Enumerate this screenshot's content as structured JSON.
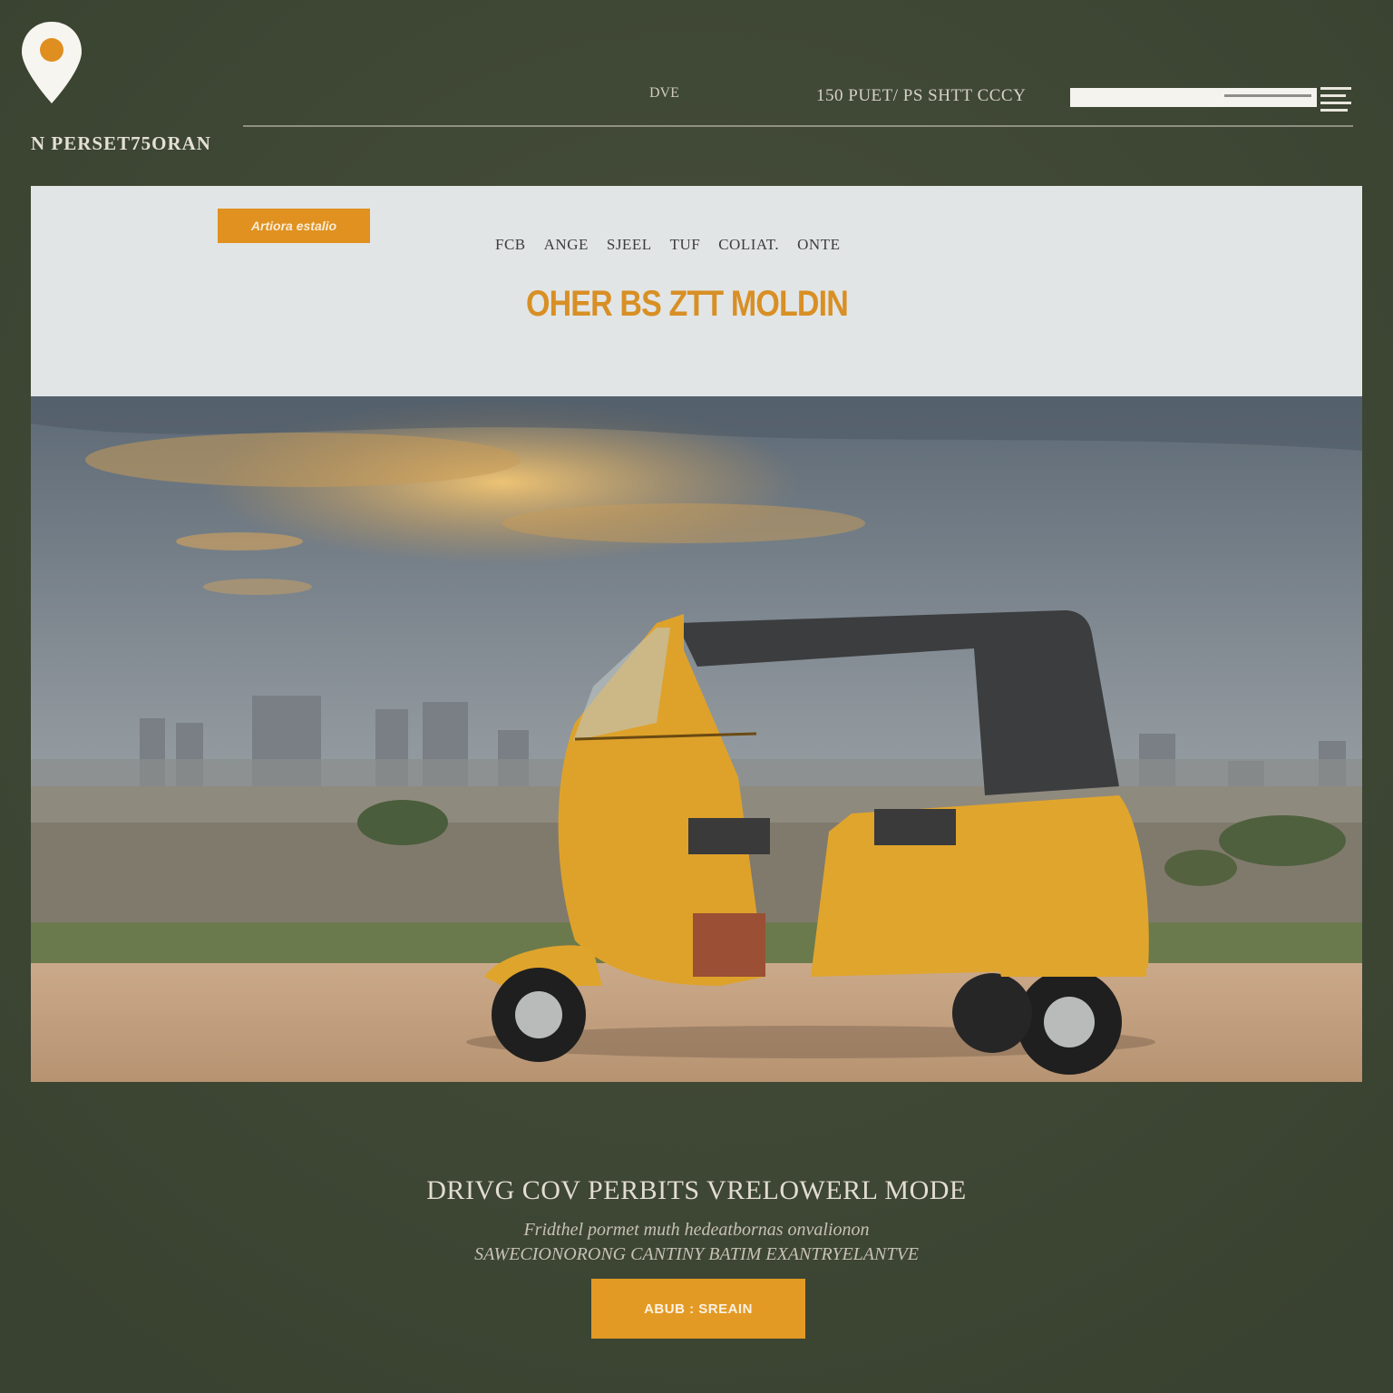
{
  "brand": {
    "name": "N PERSET75ORAN",
    "logo_icon": "location-pin-icon"
  },
  "topnav": {
    "item_one": "DVE",
    "item_two": "150 PUET/  PS  SHTT CCCY"
  },
  "search": {
    "placeholder": ""
  },
  "card": {
    "tag": "Artiora estalio",
    "categories": [
      "FCB",
      "ANGE",
      "SJEEL",
      "TUF",
      "COLIAT.",
      "ONTE"
    ],
    "headline": "OHER BS ZTT MOLDIN"
  },
  "footer": {
    "title": "DRIVG COV PERBITS   VRELOWERL MODE",
    "line1": "Fridthel pormet muth hedeatbornas onvalionon",
    "line2": "SAWECIONORONG CANTINY BATIM EXANTRYELANTVE",
    "cta": "ABUB : SREAIN"
  },
  "colors": {
    "accent": "#e39a25",
    "background": "#414a36",
    "card": "#e3e6e6"
  }
}
